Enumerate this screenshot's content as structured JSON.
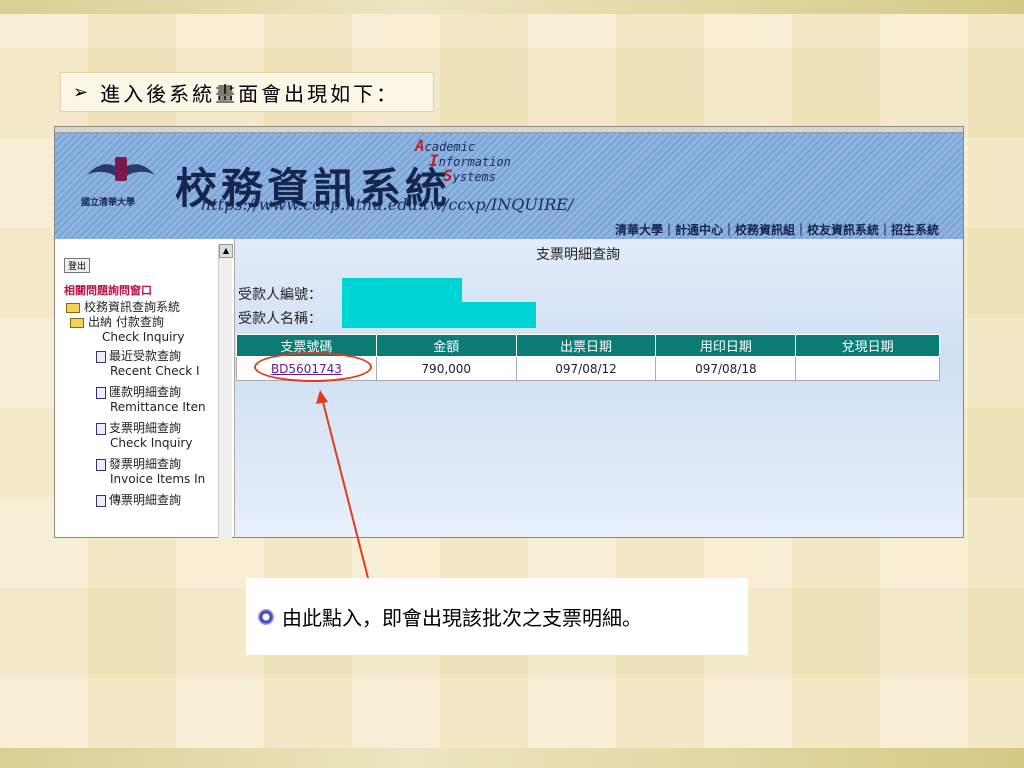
{
  "slide": {
    "title_marker": "➢",
    "title": "進入後系統畫面會出現如下：",
    "note": "由此點入，即會出現該批次之支票明細。"
  },
  "banner": {
    "school": "國立清華大學",
    "system_title": "校務資訊系統",
    "url": "https://www.ccxp.nthu.edu.tw/ccxp/INQUIRE/",
    "ais_a": "cademic",
    "ais_i": "nformation",
    "ais_s": "ystems",
    "letter_a": "A",
    "letter_i": "I",
    "letter_s": "S",
    "links": "清華大學｜計通中心｜校務資訊組｜校友資訊系統｜招生系統"
  },
  "sidebar": {
    "logout": "登出",
    "problem_link": "相關問題詢問窗口",
    "root": "校務資訊查詢系統",
    "items": [
      {
        "zh": "出納 付款查詢",
        "en": "Check Inquiry"
      },
      {
        "zh": "最近受款查詢",
        "en": "Recent Check I"
      },
      {
        "zh": "匯款明細查詢",
        "en": "Remittance Iten"
      },
      {
        "zh": "支票明細查詢",
        "en": "Check Inquiry"
      },
      {
        "zh": "發票明細查詢",
        "en": "Invoice Items In"
      },
      {
        "zh": "傳票明細查詢",
        "en": ""
      }
    ]
  },
  "main": {
    "page_title": "支票明細查詢",
    "payee_id_label": "受款人編號：",
    "payee_name_label": "受款人名稱：",
    "columns": [
      "支票號碼",
      "金額",
      "出票日期",
      "用印日期",
      "兌現日期"
    ],
    "rows": [
      {
        "check_no": "BD5601743",
        "amount": "790,000",
        "issue_date": "097/08/12",
        "seal_date": "097/08/18",
        "cash_date": ""
      }
    ]
  },
  "colors": {
    "header_teal": "#0b7b75",
    "highlight_cyan": "#00d5d5",
    "annotation_red": "#e23a20",
    "link_purple": "#6a1a9a"
  }
}
